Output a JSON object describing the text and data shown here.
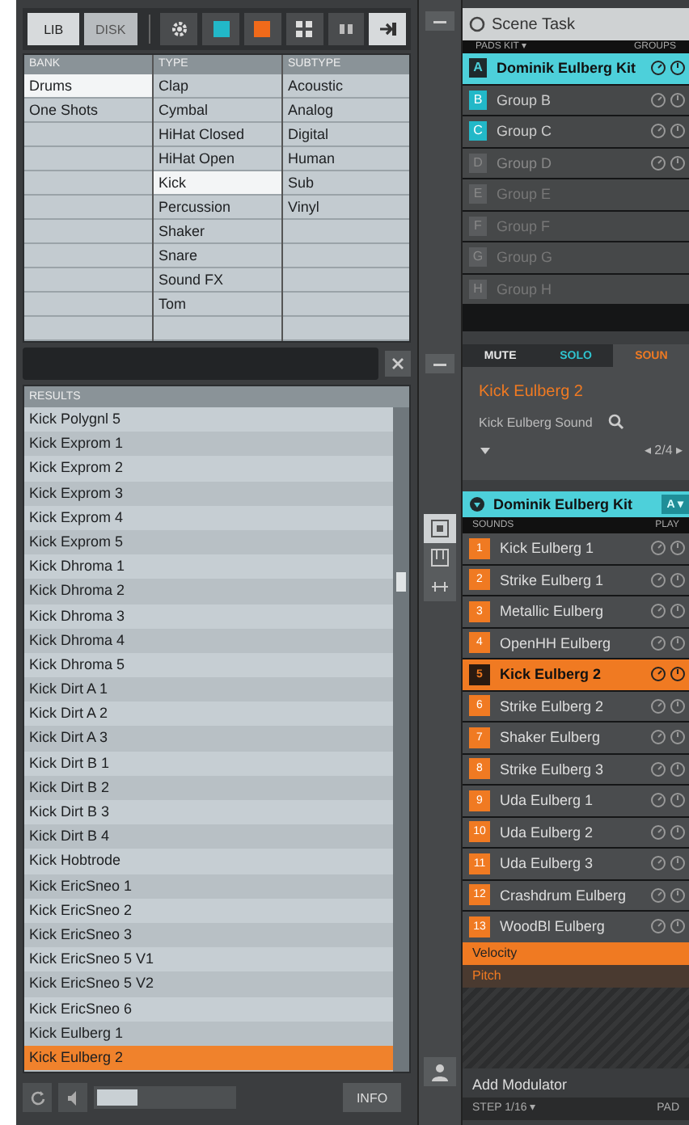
{
  "browser": {
    "tabs": [
      {
        "label": "LIB",
        "selected": true
      },
      {
        "label": "DISK",
        "selected": false
      }
    ],
    "tool_buttons": [
      {
        "kind": "gear",
        "selected": false
      },
      {
        "kind": "group",
        "selected": false
      },
      {
        "kind": "sound",
        "selected": false
      },
      {
        "kind": "grid",
        "selected": false
      },
      {
        "kind": "plugin",
        "selected": false
      },
      {
        "kind": "load",
        "selected": true
      }
    ],
    "tag_columns": [
      {
        "header": "BANK",
        "items": [
          {
            "label": "Drums",
            "selected": true
          },
          {
            "label": "One Shots",
            "selected": false
          }
        ]
      },
      {
        "header": "TYPE",
        "items": [
          {
            "label": "Clap",
            "selected": false
          },
          {
            "label": "Cymbal",
            "selected": false
          },
          {
            "label": "HiHat Closed",
            "selected": false
          },
          {
            "label": "HiHat Open",
            "selected": false
          },
          {
            "label": "Kick",
            "selected": true
          },
          {
            "label": "Percussion",
            "selected": false
          },
          {
            "label": "Shaker",
            "selected": false
          },
          {
            "label": "Snare",
            "selected": false
          },
          {
            "label": "Sound FX",
            "selected": false
          },
          {
            "label": "Tom",
            "selected": false
          }
        ]
      },
      {
        "header": "SUBTYPE",
        "items": [
          {
            "label": "Acoustic",
            "selected": false
          },
          {
            "label": "Analog",
            "selected": false
          },
          {
            "label": "Digital",
            "selected": false
          },
          {
            "label": "Human",
            "selected": false
          },
          {
            "label": "Sub",
            "selected": false
          },
          {
            "label": "Vinyl",
            "selected": false
          }
        ]
      }
    ],
    "results_header": "RESULTS",
    "results": [
      {
        "label": "Kick Polygnl 5",
        "selected": false
      },
      {
        "label": "Kick Exprom 1",
        "selected": false
      },
      {
        "label": "Kick Exprom 2",
        "selected": false
      },
      {
        "label": "Kick Exprom 3",
        "selected": false
      },
      {
        "label": "Kick Exprom 4",
        "selected": false
      },
      {
        "label": "Kick Exprom 5",
        "selected": false
      },
      {
        "label": "Kick Dhroma 1",
        "selected": false
      },
      {
        "label": "Kick Dhroma 2",
        "selected": false
      },
      {
        "label": "Kick Dhroma 3",
        "selected": false
      },
      {
        "label": "Kick Dhroma 4",
        "selected": false
      },
      {
        "label": "Kick Dhroma 5",
        "selected": false
      },
      {
        "label": "Kick Dirt A 1",
        "selected": false
      },
      {
        "label": "Kick Dirt A 2",
        "selected": false
      },
      {
        "label": "Kick Dirt A 3",
        "selected": false
      },
      {
        "label": "Kick Dirt B 1",
        "selected": false
      },
      {
        "label": "Kick Dirt B 2",
        "selected": false
      },
      {
        "label": "Kick Dirt B 3",
        "selected": false
      },
      {
        "label": "Kick Dirt B 4",
        "selected": false
      },
      {
        "label": "Kick Hobtrode",
        "selected": false
      },
      {
        "label": "Kick EricSneo 1",
        "selected": false
      },
      {
        "label": "Kick EricSneo 2",
        "selected": false
      },
      {
        "label": "Kick EricSneo 3",
        "selected": false
      },
      {
        "label": "Kick EricSneo 5 V1",
        "selected": false
      },
      {
        "label": "Kick EricSneo 5 V2",
        "selected": false
      },
      {
        "label": "Kick EricSneo 6",
        "selected": false
      },
      {
        "label": "Kick Eulberg 1",
        "selected": false
      },
      {
        "label": "Kick Eulberg 2",
        "selected": true
      }
    ],
    "zoom": {
      "level": 0.3
    },
    "info_button": "INFO"
  },
  "scene": {
    "title": "Scene Task",
    "header_left": "PADS KIT ▾",
    "header_right": "GROUPS",
    "groups": [
      {
        "letter": "A",
        "name": "Dominik Eulberg Kit",
        "kind": "loaded",
        "selected": true
      },
      {
        "letter": "B",
        "name": "Group B",
        "kind": "loaded",
        "selected": false
      },
      {
        "letter": "C",
        "name": "Group C",
        "kind": "loaded",
        "selected": false
      },
      {
        "letter": "D",
        "name": "Group D",
        "kind": "dim",
        "selected": false
      },
      {
        "letter": "E",
        "name": "Group E",
        "kind": "empty",
        "selected": false
      },
      {
        "letter": "F",
        "name": "Group F",
        "kind": "empty",
        "selected": false
      },
      {
        "letter": "G",
        "name": "Group G",
        "kind": "empty",
        "selected": false
      },
      {
        "letter": "H",
        "name": "Group H",
        "kind": "empty",
        "selected": false
      }
    ]
  },
  "mix": {
    "tabs": [
      {
        "label": "MUTE",
        "color": "#e8e8e8",
        "selected": false
      },
      {
        "label": "SOLO",
        "color": "#2fc4d0",
        "selected": false
      },
      {
        "label": "SOUN",
        "color": "#f07a22",
        "selected": true
      }
    ],
    "sound_name": "Kick Eulberg 2",
    "preset": "Kick Eulberg Sound",
    "page": "◂ 2/4 ▸"
  },
  "sounds": {
    "group": "Dominik Eulberg Kit",
    "group_button": "A ▾",
    "col_left": "SOUNDS",
    "col_right": "PLAY",
    "items": [
      {
        "number": "1",
        "name": "Kick Eulberg 1",
        "selected": false
      },
      {
        "number": "2",
        "name": "Strike Eulberg 1",
        "selected": false
      },
      {
        "number": "3",
        "name": "Metallic Eulberg",
        "selected": false
      },
      {
        "number": "4",
        "name": "OpenHH Eulberg",
        "selected": false
      },
      {
        "number": "5",
        "name": "Kick Eulberg 2",
        "selected": true
      },
      {
        "number": "6",
        "name": "Strike Eulberg 2",
        "selected": false
      },
      {
        "number": "7",
        "name": "Shaker Eulberg",
        "selected": false
      },
      {
        "number": "8",
        "name": "Strike Eulberg 3",
        "selected": false
      },
      {
        "number": "9",
        "name": "Uda Eulberg 1",
        "selected": false
      },
      {
        "number": "10",
        "name": "Uda Eulberg 2",
        "selected": false
      },
      {
        "number": "11",
        "name": "Uda Eulberg 3",
        "selected": false
      },
      {
        "number": "12",
        "name": "Crashdrum Eulberg",
        "selected": false
      },
      {
        "number": "13",
        "name": "WoodBl Eulberg",
        "selected": false
      }
    ],
    "modulators": [
      {
        "label": "Velocity",
        "selected": true
      },
      {
        "label": "Pitch",
        "selected": false
      }
    ],
    "add_label": "Add Modulator",
    "footer_left": "STEP 1/16 ▾",
    "footer_right": "PAD"
  }
}
